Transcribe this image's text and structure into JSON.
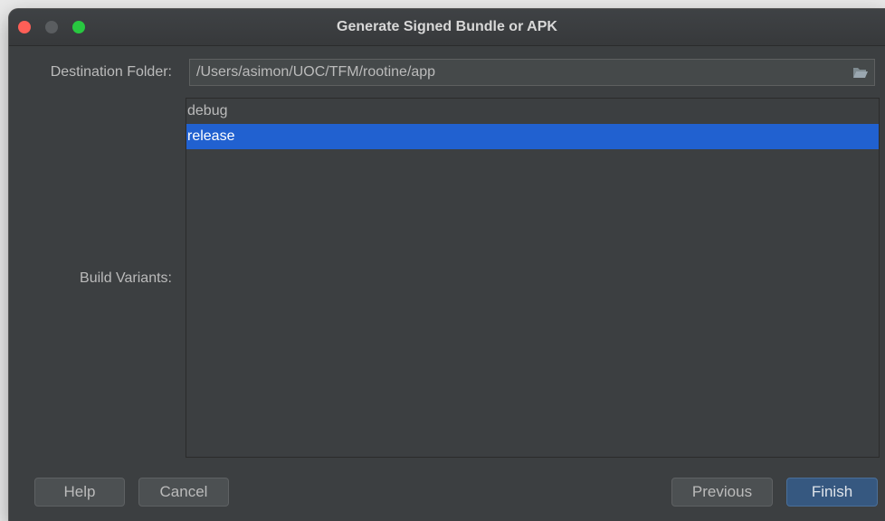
{
  "window": {
    "title": "Generate Signed Bundle or APK"
  },
  "destination": {
    "label": "Destination Folder:",
    "value": "/Users/asimon/UOC/TFM/rootine/app",
    "browse_icon": "folder-open-icon"
  },
  "build_variants": {
    "label": "Build Variants:",
    "items": [
      {
        "label": "debug",
        "selected": false
      },
      {
        "label": "release",
        "selected": true
      }
    ]
  },
  "buttons": {
    "help": "Help",
    "cancel": "Cancel",
    "previous": "Previous",
    "finish": "Finish"
  },
  "colors": {
    "window_bg": "#3c3f41",
    "selection": "#2161d0",
    "default_button": "#365880"
  }
}
